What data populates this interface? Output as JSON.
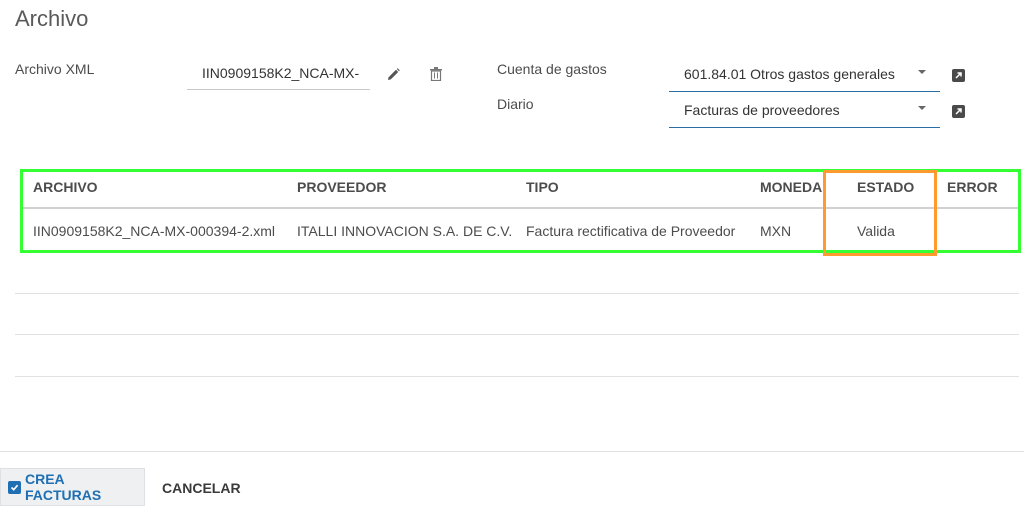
{
  "page": {
    "title": "Archivo"
  },
  "form": {
    "xml_label": "Archivo XML",
    "xml_value": "IIN0909158K2_NCA-MX-",
    "cuenta_label": "Cuenta de gastos",
    "cuenta_value": "601.84.01 Otros gastos generales",
    "diario_label": "Diario",
    "diario_value": "Facturas de proveedores"
  },
  "table": {
    "headers": [
      "ARCHIVO",
      "PROVEEDOR",
      "TIPO",
      "MONEDA",
      "ESTADO",
      "ERROR"
    ],
    "rows": [
      [
        "IIN0909158K2_NCA-MX-000394-2.xml",
        "ITALLI INNOVACION S.A. DE C.V.",
        "Factura rectificativa de Proveedor",
        "MXN",
        "Valida",
        ""
      ]
    ]
  },
  "footer": {
    "create_label": "CREA FACTURAS",
    "cancel_label": "CANCELAR"
  },
  "colors": {
    "accent": "#1f6fb2",
    "highlight_table": "#33ff33",
    "highlight_estado": "#ff9a2e"
  },
  "icons": [
    "pencil-icon",
    "trash-icon",
    "external-link-icon",
    "checkbox-icon",
    "caret-down-icon"
  ]
}
